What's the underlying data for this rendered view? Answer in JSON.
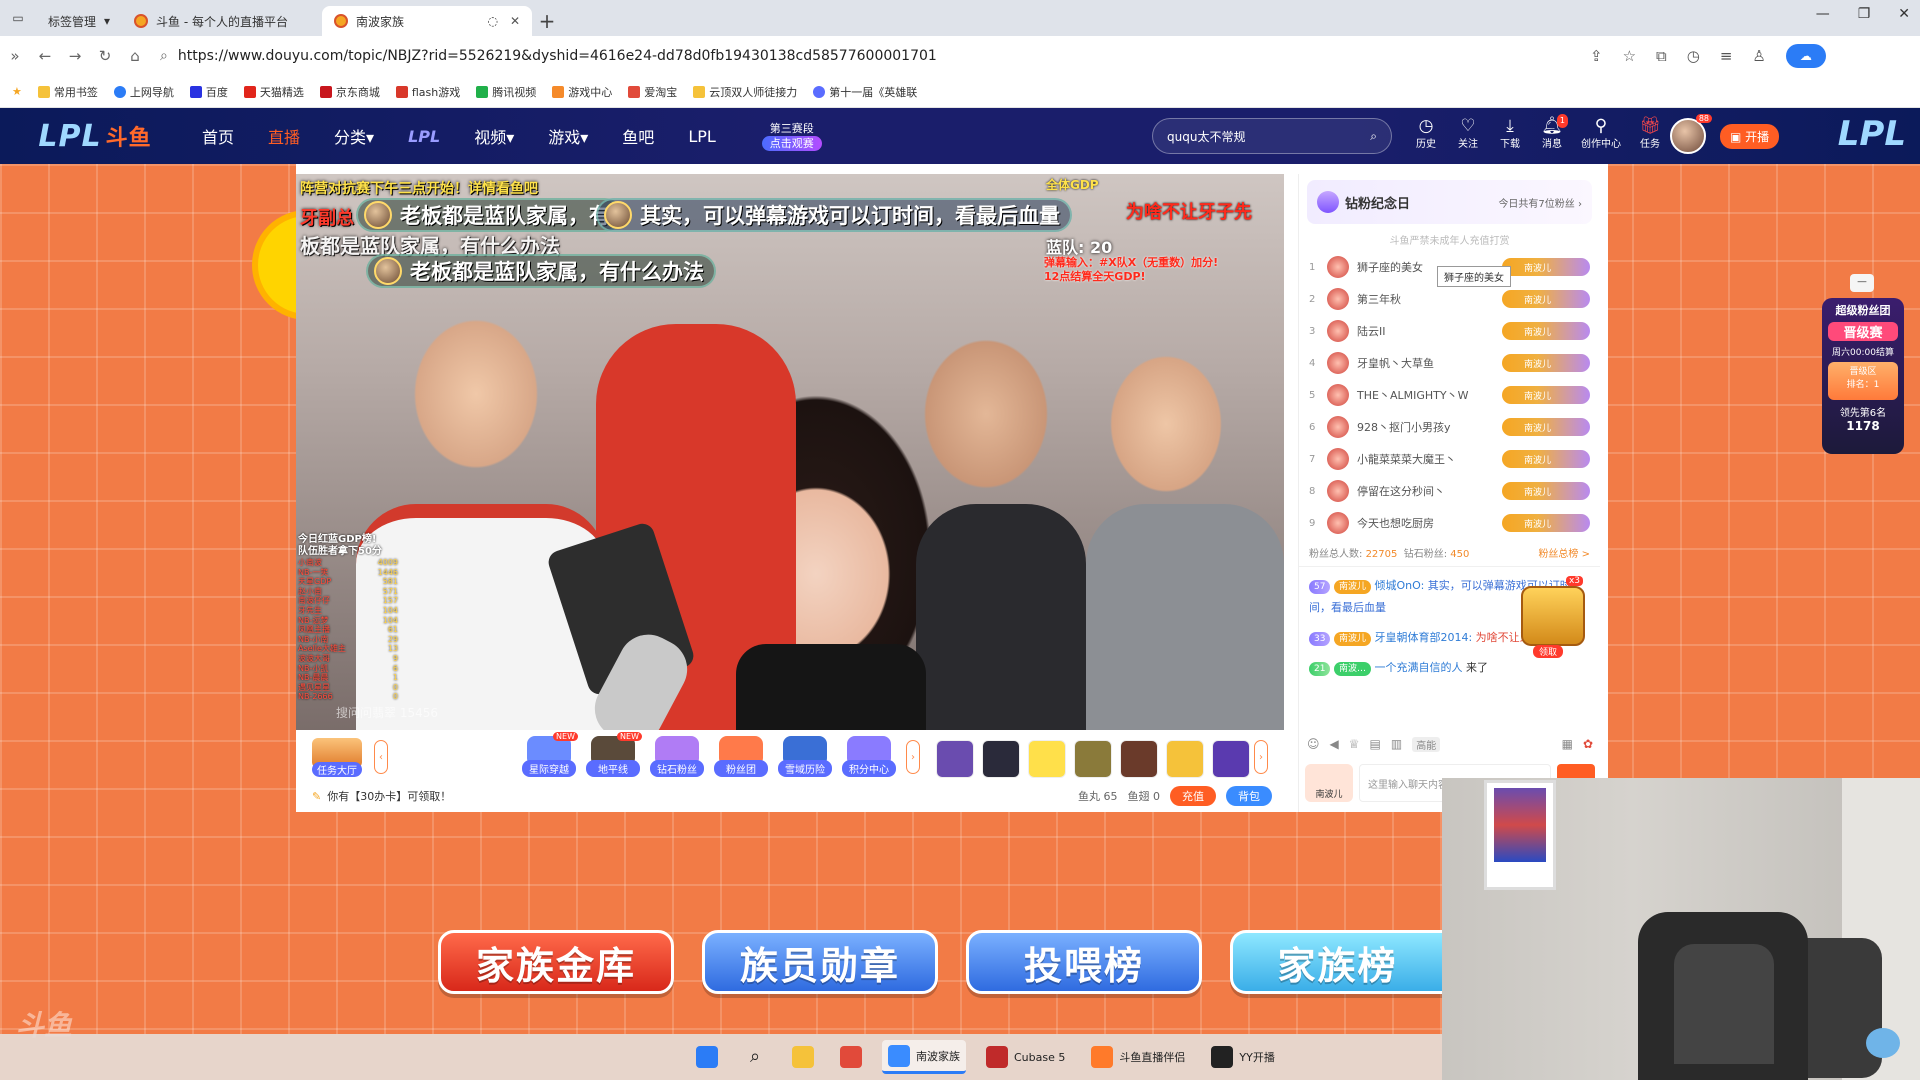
{
  "browser": {
    "tab_group_label": "标签管理",
    "tabs": [
      {
        "title": "斗鱼 - 每个人的直播平台",
        "active": false
      },
      {
        "title": "南波家族",
        "active": true
      }
    ],
    "new_tab": "+",
    "url": "https://www.douyu.com/topic/NBJZ?rid=5526219&dyshid=4616e24-dd78d0fb19430138cd58577600001701",
    "bookmarks": [
      "常用书签",
      "上网导航",
      "百度",
      "天猫精选",
      "京东商城",
      "flash游戏",
      "腾讯视频",
      "游戏中心",
      "爱淘宝",
      "云顶双人师徒接力",
      "第十一届《英雄联"
    ]
  },
  "site": {
    "logo_text": "LPL",
    "logo_brand": "斗鱼",
    "nav": [
      {
        "label": "首页",
        "active": false
      },
      {
        "label": "直播",
        "active": true
      },
      {
        "label": "分类",
        "active": false,
        "dropdown": true
      },
      {
        "label": "LPL",
        "active": false,
        "style": "logo"
      },
      {
        "label": "视频",
        "active": false,
        "dropdown": true
      },
      {
        "label": "游戏",
        "active": false,
        "dropdown": true
      },
      {
        "label": "鱼吧",
        "active": false
      },
      {
        "label": "LPL",
        "active": false
      }
    ],
    "stage_line1": "第三赛段",
    "stage_line2": "点击观赛",
    "search_placeholder": "ququ太不常规",
    "header_icons": [
      {
        "icon": "history-icon",
        "label": "历史"
      },
      {
        "icon": "heart-icon",
        "label": "关注"
      },
      {
        "icon": "download-icon",
        "label": "下载"
      },
      {
        "icon": "bell-icon",
        "label": "消息",
        "badge": "1"
      },
      {
        "icon": "creator-icon",
        "label": "创作中心"
      },
      {
        "icon": "gift-box-icon",
        "label": "任务"
      }
    ],
    "avatar_badge": "88",
    "open_live_label": "开播",
    "right_logo": "LPL"
  },
  "video": {
    "top_banner": "阵营对抗赛下午三点开始！详情看鱼吧",
    "sign_text": "牙副总",
    "danmaku": [
      {
        "text": "老板都是蓝队家属，有"
      },
      {
        "text": "其实，可以弹幕游戏可以订时间，看最后血量"
      },
      {
        "text": "老板都是蓝队家属，有什么办法"
      }
    ],
    "ghost_text": "板都是蓝队家属，有什么办法",
    "gdp_label": "全体GDP",
    "blue_team": "蓝队: 20",
    "red_note_1": "弹幕输入：#X队X（无重数）加分!",
    "red_note_2": "12点结算全天GDP!",
    "red_right": "为啥不让牙子先",
    "rank_title": "今日红蓝GDP榜!",
    "rank_subtitle": "队伍胜者拿下50分",
    "rank_rows": [
      {
        "name": "小南波",
        "value": "4009"
      },
      {
        "name": "NB-一笑",
        "value": "1446"
      },
      {
        "name": "天星GDP",
        "value": "581"
      },
      {
        "name": "赵小南",
        "value": "571"
      },
      {
        "name": "南波仔仔",
        "value": "157"
      },
      {
        "name": "牙先生",
        "value": "104"
      },
      {
        "name": "NB-远梦",
        "value": "104"
      },
      {
        "name": "凤凰主播",
        "value": "61"
      },
      {
        "name": "NB-小南",
        "value": "29"
      },
      {
        "name": "Aselle大雄主",
        "value": "13"
      },
      {
        "name": "波波大哥",
        "value": "9"
      },
      {
        "name": "NB-小凯",
        "value": "6"
      },
      {
        "name": "NB-晨晨",
        "value": "1"
      },
      {
        "name": "遇见星星",
        "value": "0"
      },
      {
        "name": "NB-2666",
        "value": "0"
      }
    ],
    "watermark": "搜问问翡翠  15456"
  },
  "toolbar": {
    "task_hall": "任务大厅",
    "items": [
      {
        "label": "星际穿越",
        "new": true,
        "color": "#6b8cff"
      },
      {
        "label": "地平线",
        "new": true,
        "color": "#5a4a3a"
      },
      {
        "label": "钻石粉丝",
        "new": false,
        "color": "#b07cf5"
      },
      {
        "label": "粉丝团",
        "new": false,
        "color": "#ff7a4a"
      },
      {
        "label": "雪域历险",
        "new": false,
        "color": "#3a6fd6"
      },
      {
        "label": "积分中心",
        "new": false,
        "color": "#8a7bff"
      }
    ],
    "new_label": "NEW",
    "gifts": [
      "#6a4caf",
      "#2a2a3a",
      "#ffe04a",
      "#8a7a3a",
      "#6a3a2a",
      "#f5c23a",
      "#5a3aaf"
    ],
    "notice": "你有【30办卡】可领取！",
    "fish_balls": "鱼丸 65",
    "fish_fins": "鱼翅 0",
    "charge_label": "充值",
    "bag_label": "背包"
  },
  "fan_panel": {
    "title": "钻粉纪念日",
    "today_count": "今日共有7位粉丝",
    "notice": "斗鱼严禁未成年人充值打赏",
    "rows": [
      {
        "rank": "1",
        "name": "狮子座的美女"
      },
      {
        "rank": "2",
        "name": "第三年秋"
      },
      {
        "rank": "3",
        "name": "陆云II"
      },
      {
        "rank": "4",
        "name": "牙皇帆丶大草鱼"
      },
      {
        "rank": "5",
        "name": "THE丶ALMIGHTY丶W"
      },
      {
        "rank": "6",
        "name": "928丶抠门小男孩y"
      },
      {
        "rank": "7",
        "name": "小龍菜菜菜大魔王丶"
      },
      {
        "rank": "8",
        "name": "停留在这分秒间丶"
      },
      {
        "rank": "9",
        "name": "今天也想吃厨房"
      }
    ],
    "fan_tag": "南波儿",
    "tooltip": "狮子座的美女",
    "total_label": "粉丝总人数:",
    "total_value": "22705",
    "diamond_label": "钻石粉丝:",
    "diamond_value": "450",
    "rank_link": "粉丝总榜 >"
  },
  "chat": {
    "messages": [
      {
        "level": "57",
        "fan": "南波儿",
        "user": "倾城OnO:",
        "text": "其实，可以弹幕游戏可以订时间，看最后血量",
        "style": "blue"
      },
      {
        "level": "33",
        "fan": "南波儿",
        "user": "牙皇朝体育部2014:",
        "text": "为啥不让牙子先上",
        "style": "red"
      },
      {
        "level": "21",
        "fan": "南波…",
        "user": "一个充满自信的人",
        "text": "来了",
        "style": "enter"
      }
    ],
    "chest_count": "x3",
    "chest_label": "领取",
    "tools_label": "高能",
    "input_placeholder": "这里输入聊天内容",
    "fan_tag_label": "南波儿"
  },
  "super_fan": {
    "title": "超级粉丝团",
    "stage": "晋级赛",
    "time": "周六00:00结算",
    "zone": "晋级区",
    "rank": "排名：1",
    "ahead_label": "领先第6名",
    "ahead_value": "1178",
    "collapse": "−"
  },
  "big_buttons": [
    {
      "label": "家族金库",
      "color": "red"
    },
    {
      "label": "族员勋章",
      "color": "blue"
    },
    {
      "label": "投喂榜",
      "color": "blue"
    },
    {
      "label": "家族榜",
      "color": "cyan"
    }
  ],
  "bottom_watermark": "斗鱼",
  "taskbar": {
    "items": [
      {
        "label": "",
        "icon": "windows-start-icon",
        "color": "#2b7cf6"
      },
      {
        "label": "",
        "icon": "search-icon",
        "color": "transparent"
      },
      {
        "label": "",
        "icon": "folder-icon",
        "color": "#f5c23a"
      },
      {
        "label": "",
        "icon": "wps-icon",
        "color": "#e14a3a"
      },
      {
        "label": "南波家族",
        "icon": "browser-icon",
        "color": "#3a8cff",
        "active": true
      },
      {
        "label": "Cubase 5",
        "icon": "cubase-icon",
        "color": "#c02a2a"
      },
      {
        "label": "斗鱼直播伴侣",
        "icon": "douyu-companion-icon",
        "color": "#ff7a2a"
      },
      {
        "label": "YY开播",
        "icon": "yy-icon",
        "color": "#222"
      }
    ]
  }
}
